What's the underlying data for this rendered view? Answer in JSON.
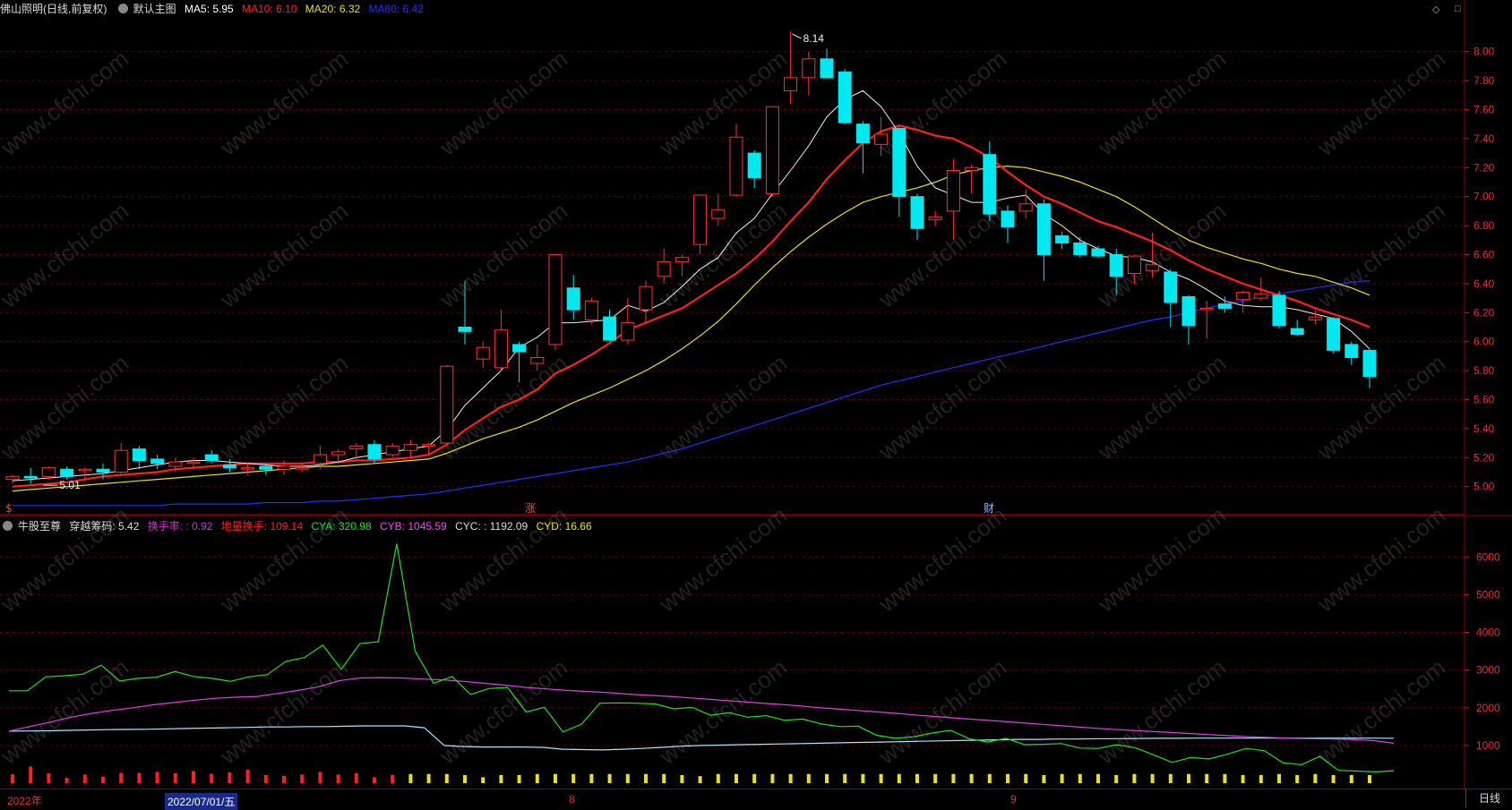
{
  "top_panel": {
    "stock": "佛山照明(日线,前复权)",
    "template": "默认主图",
    "ma5": {
      "label": "MA5: 5.95",
      "color": "#ffffff"
    },
    "ma10": {
      "label": "MA10: 6.10",
      "color": "#ff2020"
    },
    "ma20": {
      "label": "MA20: 6.32",
      "color": "#e8e020"
    },
    "ma60": {
      "label": "MA60: 6.42",
      "color": "#2030ff"
    },
    "corner_icons": [
      "diamond-icon",
      "square-icon"
    ],
    "high_label": "8.14",
    "low_label": "5.01",
    "markers": [
      "$",
      "涨",
      "财"
    ]
  },
  "bottom_panel": {
    "name": "牛股至尊",
    "items": [
      {
        "label": "穿越筹码: 5.42",
        "color": "#dddddd"
      },
      {
        "label": "换手率: : 0.92",
        "color": "#d030d0"
      },
      {
        "label": "地量换手: 109.14",
        "color": "#ff2020"
      },
      {
        "label": "CYA: 320.98",
        "color": "#20e020"
      },
      {
        "label": "CYB: 1045.59",
        "color": "#ff40ff"
      },
      {
        "label": "CYC: : 1192.09",
        "color": "#dddddd"
      },
      {
        "label": "CYD: 16.66",
        "color": "#e8e020"
      }
    ]
  },
  "price_axis": [
    "8.00",
    "7.80",
    "7.60",
    "7.40",
    "7.20",
    "7.00",
    "6.80",
    "6.60",
    "6.40",
    "6.20",
    "6.00",
    "5.80",
    "5.60",
    "5.40",
    "5.20",
    "5.00"
  ],
  "volume_axis": [
    "6000",
    "5000",
    "4000",
    "3000",
    "2000",
    "1000"
  ],
  "date_axis": {
    "year": "2022年",
    "cursor_date": "2022/07/01/五",
    "month8": "8",
    "month9": "9"
  },
  "period_button": "日线",
  "watermark": "www.cfchi.com",
  "chart_data": {
    "type": "candlestick",
    "price_ylim": [
      4.85,
      8.22
    ],
    "candles": [
      [
        5.05,
        5.08,
        5.02,
        5.07
      ],
      [
        5.07,
        5.13,
        5.02,
        5.06
      ],
      [
        5.07,
        5.14,
        5.05,
        5.13
      ],
      [
        5.12,
        5.14,
        5.05,
        5.07
      ],
      [
        5.11,
        5.13,
        5.04,
        5.12
      ],
      [
        5.12,
        5.16,
        5.05,
        5.1
      ],
      [
        5.1,
        5.3,
        5.08,
        5.25
      ],
      [
        5.26,
        5.28,
        5.12,
        5.18
      ],
      [
        5.19,
        5.22,
        5.12,
        5.16
      ],
      [
        5.14,
        5.2,
        5.1,
        5.17
      ],
      [
        5.17,
        5.2,
        5.12,
        5.17
      ],
      [
        5.22,
        5.25,
        5.16,
        5.18
      ],
      [
        5.15,
        5.19,
        5.1,
        5.13
      ],
      [
        5.13,
        5.16,
        5.08,
        5.13
      ],
      [
        5.14,
        5.16,
        5.08,
        5.12
      ],
      [
        5.12,
        5.18,
        5.08,
        5.14
      ],
      [
        5.13,
        5.16,
        5.1,
        5.13
      ],
      [
        5.16,
        5.28,
        5.12,
        5.22
      ],
      [
        5.22,
        5.26,
        5.16,
        5.24
      ],
      [
        5.26,
        5.3,
        5.18,
        5.28
      ],
      [
        5.29,
        5.32,
        5.16,
        5.19
      ],
      [
        5.22,
        5.3,
        5.2,
        5.28
      ],
      [
        5.25,
        5.32,
        5.2,
        5.29
      ],
      [
        5.28,
        5.3,
        5.22,
        5.29
      ],
      [
        5.3,
        5.84,
        5.28,
        5.83
      ],
      [
        6.1,
        6.42,
        5.98,
        6.07
      ],
      [
        5.88,
        6.0,
        5.82,
        5.96
      ],
      [
        5.82,
        6.22,
        5.8,
        6.08
      ],
      [
        5.98,
        6.0,
        5.72,
        5.93
      ],
      [
        5.85,
        5.98,
        5.8,
        5.89
      ],
      [
        5.98,
        6.6,
        5.94,
        6.6
      ],
      [
        6.37,
        6.46,
        6.15,
        6.22
      ],
      [
        6.15,
        6.3,
        6.12,
        6.28
      ],
      [
        6.17,
        6.22,
        6.0,
        6.01
      ],
      [
        6.01,
        6.3,
        5.98,
        6.13
      ],
      [
        6.22,
        6.42,
        6.12,
        6.38
      ],
      [
        6.45,
        6.64,
        6.4,
        6.55
      ],
      [
        6.55,
        6.6,
        6.45,
        6.58
      ],
      [
        6.67,
        7.0,
        6.6,
        7.01
      ],
      [
        6.85,
        7.02,
        6.8,
        6.91
      ],
      [
        7.01,
        7.5,
        7.0,
        7.41
      ],
      [
        7.3,
        7.32,
        7.06,
        7.13
      ],
      [
        7.02,
        7.62,
        7.0,
        7.62
      ],
      [
        7.73,
        8.14,
        7.64,
        7.82
      ],
      [
        7.82,
        8.0,
        7.7,
        7.95
      ],
      [
        7.95,
        8.02,
        7.84,
        7.82
      ],
      [
        7.86,
        7.88,
        7.5,
        7.51
      ],
      [
        7.5,
        7.52,
        7.16,
        7.37
      ],
      [
        7.36,
        7.55,
        7.28,
        7.43
      ],
      [
        7.47,
        7.48,
        6.86,
        7.0
      ],
      [
        7.0,
        7.02,
        6.7,
        6.78
      ],
      [
        6.84,
        6.9,
        6.8,
        6.86
      ],
      [
        6.9,
        7.26,
        6.7,
        7.18
      ],
      [
        7.18,
        7.22,
        7.02,
        7.2
      ],
      [
        7.29,
        7.38,
        6.83,
        6.88
      ],
      [
        6.9,
        6.94,
        6.68,
        6.79
      ],
      [
        6.9,
        7.05,
        6.85,
        6.95
      ],
      [
        6.95,
        6.98,
        6.42,
        6.6
      ],
      [
        6.73,
        6.76,
        6.64,
        6.68
      ],
      [
        6.68,
        6.72,
        6.58,
        6.6
      ],
      [
        6.64,
        6.66,
        6.58,
        6.59
      ],
      [
        6.6,
        6.64,
        6.32,
        6.45
      ],
      [
        6.47,
        6.6,
        6.4,
        6.59
      ],
      [
        6.49,
        6.75,
        6.44,
        6.53
      ],
      [
        6.48,
        6.5,
        6.1,
        6.27
      ],
      [
        6.31,
        6.32,
        5.98,
        6.11
      ],
      [
        6.23,
        6.28,
        6.02,
        6.23
      ],
      [
        6.26,
        6.31,
        6.2,
        6.23
      ],
      [
        6.29,
        6.35,
        6.2,
        6.34
      ],
      [
        6.3,
        6.44,
        6.28,
        6.33
      ],
      [
        6.32,
        6.35,
        6.09,
        6.11
      ],
      [
        6.09,
        6.15,
        6.04,
        6.05
      ],
      [
        6.15,
        6.22,
        6.12,
        6.17
      ],
      [
        6.16,
        6.17,
        5.92,
        5.94
      ],
      [
        5.98,
        6.0,
        5.84,
        5.89
      ],
      [
        5.94,
        5.95,
        5.68,
        5.76
      ]
    ],
    "ma5": [
      5.04,
      5.05,
      5.06,
      5.07,
      5.08,
      5.09,
      5.11,
      5.13,
      5.15,
      5.17,
      5.18,
      5.18,
      5.17,
      5.16,
      5.15,
      5.14,
      5.14,
      5.15,
      5.17,
      5.2,
      5.22,
      5.24,
      5.26,
      5.28,
      5.39,
      5.56,
      5.68,
      5.8,
      5.96,
      6.03,
      6.13,
      6.13,
      6.14,
      6.15,
      6.25,
      6.21,
      6.27,
      6.38,
      6.5,
      6.58,
      6.75,
      6.85,
      7.02,
      7.18,
      7.35,
      7.55,
      7.67,
      7.73,
      7.62,
      7.44,
      7.21,
      7.06,
      7.01,
      6.96,
      6.96,
      6.99,
      7.01,
      6.88,
      6.8,
      6.7,
      6.64,
      6.59,
      6.58,
      6.55,
      6.48,
      6.43,
      6.36,
      6.28,
      6.25,
      6.24,
      6.24,
      6.22,
      6.19,
      6.16,
      6.07,
      5.95
    ],
    "ma10": [
      5.0,
      5.01,
      5.02,
      5.03,
      5.05,
      5.07,
      5.08,
      5.09,
      5.1,
      5.12,
      5.13,
      5.14,
      5.15,
      5.16,
      5.16,
      5.16,
      5.16,
      5.17,
      5.17,
      5.18,
      5.18,
      5.19,
      5.2,
      5.22,
      5.29,
      5.39,
      5.47,
      5.55,
      5.6,
      5.67,
      5.78,
      5.84,
      5.91,
      5.99,
      6.08,
      6.13,
      6.18,
      6.23,
      6.31,
      6.39,
      6.47,
      6.57,
      6.69,
      6.83,
      6.96,
      7.12,
      7.25,
      7.37,
      7.45,
      7.49,
      7.46,
      7.42,
      7.4,
      7.34,
      7.27,
      7.17,
      7.08,
      7.0,
      6.95,
      6.89,
      6.83,
      6.79,
      6.74,
      6.69,
      6.63,
      6.56,
      6.5,
      6.45,
      6.4,
      6.36,
      6.32,
      6.28,
      6.23,
      6.19,
      6.15,
      6.1
    ],
    "ma20": [
      4.97,
      4.98,
      4.99,
      5.0,
      5.01,
      5.02,
      5.03,
      5.04,
      5.05,
      5.06,
      5.07,
      5.08,
      5.09,
      5.1,
      5.11,
      5.12,
      5.13,
      5.14,
      5.14,
      5.15,
      5.16,
      5.17,
      5.18,
      5.19,
      5.23,
      5.28,
      5.33,
      5.37,
      5.41,
      5.46,
      5.52,
      5.58,
      5.63,
      5.68,
      5.74,
      5.8,
      5.87,
      5.95,
      6.04,
      6.14,
      6.26,
      6.39,
      6.51,
      6.62,
      6.72,
      6.81,
      6.89,
      6.96,
      7.0,
      7.03,
      7.06,
      7.1,
      7.15,
      7.18,
      7.2,
      7.21,
      7.2,
      7.17,
      7.14,
      7.1,
      7.05,
      7.0,
      6.93,
      6.85,
      6.77,
      6.7,
      6.65,
      6.61,
      6.57,
      6.54,
      6.5,
      6.47,
      6.45,
      6.41,
      6.37,
      6.32
    ],
    "ma60": [
      4.87,
      4.87,
      4.87,
      4.87,
      4.87,
      4.87,
      4.87,
      4.87,
      4.87,
      4.88,
      4.88,
      4.88,
      4.88,
      4.88,
      4.89,
      4.89,
      4.89,
      4.9,
      4.9,
      4.91,
      4.92,
      4.93,
      4.94,
      4.95,
      4.97,
      4.99,
      5.01,
      5.03,
      5.05,
      5.07,
      5.09,
      5.11,
      5.13,
      5.15,
      5.17,
      5.2,
      5.23,
      5.26,
      5.3,
      5.34,
      5.38,
      5.42,
      5.46,
      5.5,
      5.54,
      5.58,
      5.62,
      5.66,
      5.7,
      5.73,
      5.76,
      5.79,
      5.82,
      5.85,
      5.88,
      5.91,
      5.94,
      5.97,
      6.0,
      6.03,
      6.06,
      6.09,
      6.12,
      6.15,
      6.17,
      6.2,
      6.23,
      6.26,
      6.28,
      6.31,
      6.33,
      6.35,
      6.37,
      6.39,
      6.41,
      6.42
    ],
    "volume_ylim": [
      0,
      6600
    ],
    "cya": [
      2450,
      2450,
      2820,
      2850,
      2890,
      3130,
      2710,
      2780,
      2810,
      2960,
      2830,
      2780,
      2700,
      2820,
      2880,
      3230,
      3330,
      3660,
      3020,
      3700,
      3750,
      6350,
      3500,
      2650,
      2830,
      2350,
      2510,
      2540,
      1890,
      2010,
      1360,
      1560,
      2120,
      2130,
      2120,
      2100,
      1970,
      2010,
      1800,
      1870,
      1750,
      1790,
      1670,
      1700,
      1570,
      1500,
      1510,
      1270,
      1190,
      1230,
      1330,
      1400,
      1180,
      1090,
      1190,
      1020,
      1030,
      1050,
      930,
      920,
      1020,
      940,
      750,
      550,
      680,
      640,
      770,
      920,
      860,
      540,
      490,
      710,
      340,
      320,
      300,
      330
    ],
    "cyb": [
      1380,
      1500,
      1620,
      1750,
      1850,
      1930,
      2000,
      2080,
      2140,
      2200,
      2250,
      2280,
      2300,
      2380,
      2460,
      2560,
      2720,
      2790,
      2800,
      2790,
      2760,
      2740,
      2700,
      2650,
      2600,
      2540,
      2500,
      2460,
      2430,
      2400,
      2360,
      2330,
      2300,
      2260,
      2220,
      2180,
      2140,
      2100,
      2060,
      2010,
      1970,
      1930,
      1890,
      1850,
      1800,
      1760,
      1720,
      1680,
      1640,
      1600,
      1560,
      1520,
      1480,
      1440,
      1410,
      1380,
      1350,
      1320,
      1290,
      1260,
      1230,
      1210,
      1190,
      1180,
      1170,
      1160,
      1130,
      1060
    ],
    "cyc": [
      1380,
      1385,
      1390,
      1400,
      1410,
      1420,
      1425,
      1430,
      1440,
      1450,
      1460,
      1470,
      1480,
      1490,
      1490,
      1500,
      1500,
      1510,
      1520,
      1520,
      1520,
      1470,
      1000,
      970,
      960,
      960,
      960,
      950,
      900,
      890,
      880,
      900,
      920,
      950,
      980,
      1000,
      1010,
      1020,
      1030,
      1040,
      1050,
      1060,
      1070,
      1080,
      1090,
      1100,
      1110,
      1120,
      1130,
      1140,
      1150,
      1160,
      1160,
      1170,
      1170,
      1180,
      1180,
      1185,
      1190,
      1190,
      1195,
      1195,
      1195,
      1195,
      1195,
      1195,
      1195,
      1195,
      1195,
      1193,
      1192
    ],
    "turnover": [
      0.33,
      0.62,
      0.37,
      0.2,
      0.32,
      0.24,
      0.38,
      0.38,
      0.42,
      0.37,
      0.45,
      0.35,
      0.4,
      0.5,
      0.3,
      0.27,
      0.32,
      0.42,
      0.32,
      0.37,
      0.22,
      0.3,
      0.34,
      0.34,
      0.34,
      0.3,
      0.22,
      0.3,
      0.3,
      0.34,
      0.34,
      0.34,
      0.34,
      0.34,
      0.34,
      0.34,
      0.34,
      0.3,
      0.26,
      0.34,
      0.34,
      0.34,
      0.34,
      0.34,
      0.34,
      0.34,
      0.34,
      0.34,
      0.34,
      0.34,
      0.34,
      0.34,
      0.34,
      0.34,
      0.34,
      0.34,
      0.34,
      0.3,
      0.34,
      0.34,
      0.34,
      0.3,
      0.34,
      0.34,
      0.34,
      0.34,
      0.34,
      0.34,
      0.3,
      0.3,
      0.34,
      0.3,
      0.34,
      0.3,
      0.3,
      0.3
    ]
  }
}
